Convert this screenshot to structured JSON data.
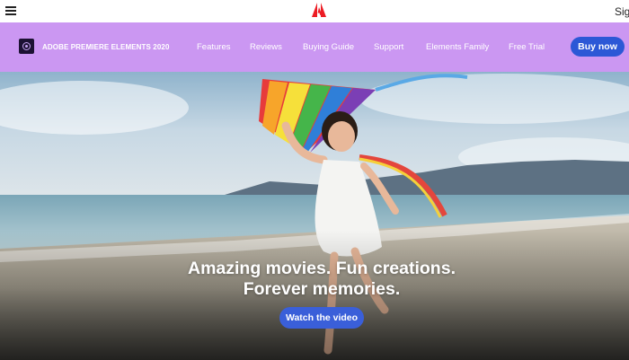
{
  "topbar": {
    "menu_icon": "hamburger-menu-icon",
    "logo_icon": "adobe-logo-icon",
    "signin_label": "Sig",
    "brand_color": "#ec1c24"
  },
  "subnav": {
    "background": "#cb97f2",
    "product_icon": "premiere-elements-icon",
    "product_name": "ADOBE PREMIERE ELEMENTS 2020",
    "links": [
      "Features",
      "Reviews",
      "Buying Guide",
      "Support",
      "Elements Family",
      "Free Trial"
    ],
    "buy_label": "Buy now",
    "buy_color": "#2c58d6"
  },
  "hero": {
    "line1": "Amazing movies. Fun creations.",
    "line2": "Forever memories.",
    "watch_label": "Watch the video",
    "watch_color": "#3a5fd9"
  }
}
